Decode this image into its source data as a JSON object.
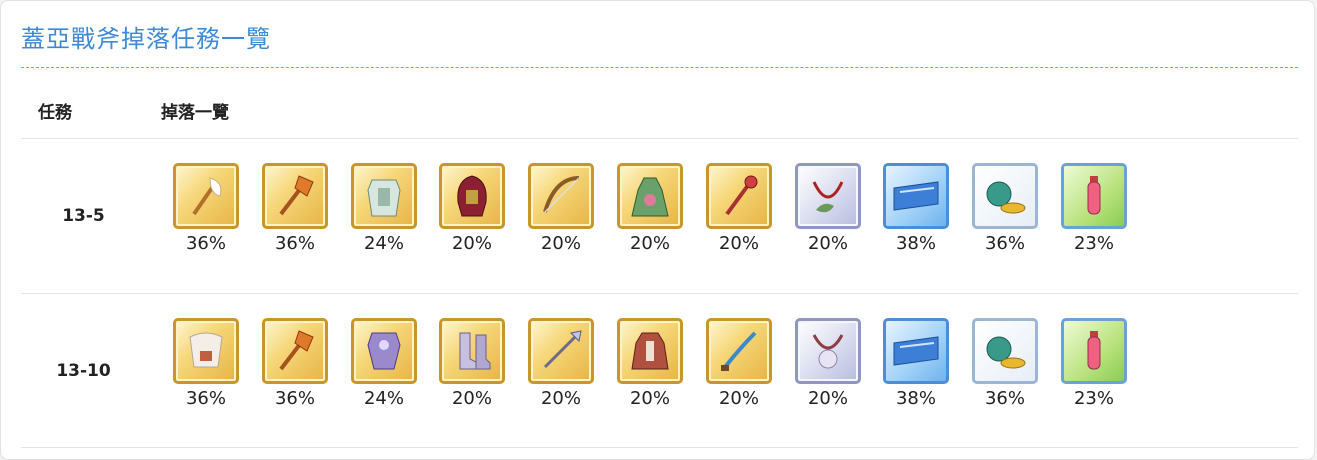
{
  "title": "蓋亞戰斧掉落任務一覽",
  "headers": {
    "mission": "任務",
    "drops": "掉落一覽"
  },
  "rows": [
    {
      "mission": "13-5",
      "drops": [
        {
          "icon": "feather-staff-icon",
          "rarity": "gold",
          "rate": "36%"
        },
        {
          "icon": "axe-icon",
          "rarity": "gold",
          "rate": "36%"
        },
        {
          "icon": "armor-icon",
          "rarity": "gold",
          "rate": "24%"
        },
        {
          "icon": "hood-icon",
          "rarity": "gold",
          "rate": "20%"
        },
        {
          "icon": "bow-icon",
          "rarity": "gold",
          "rate": "20%"
        },
        {
          "icon": "dress-icon",
          "rarity": "gold",
          "rate": "20%"
        },
        {
          "icon": "scepter-icon",
          "rarity": "gold",
          "rate": "20%"
        },
        {
          "icon": "laurel-amulet-icon",
          "rarity": "silver",
          "rate": "20%"
        },
        {
          "icon": "ticket-icon",
          "rarity": "blue",
          "rate": "38%"
        },
        {
          "icon": "coin-pouch-icon",
          "rarity": "white",
          "rate": "36%"
        },
        {
          "icon": "potion-icon",
          "rarity": "green",
          "rate": "23%"
        }
      ]
    },
    {
      "mission": "13-10",
      "drops": [
        {
          "icon": "beast-cloak-icon",
          "rarity": "gold",
          "rate": "36%"
        },
        {
          "icon": "axe-icon",
          "rarity": "gold",
          "rate": "36%"
        },
        {
          "icon": "knight-armor-icon",
          "rarity": "gold",
          "rate": "24%"
        },
        {
          "icon": "boots-icon",
          "rarity": "gold",
          "rate": "20%"
        },
        {
          "icon": "spear-icon",
          "rarity": "gold",
          "rate": "20%"
        },
        {
          "icon": "robe-icon",
          "rarity": "gold",
          "rate": "20%"
        },
        {
          "icon": "blade-icon",
          "rarity": "gold",
          "rate": "20%"
        },
        {
          "icon": "pendant-icon",
          "rarity": "silver",
          "rate": "20%"
        },
        {
          "icon": "ticket-icon",
          "rarity": "blue",
          "rate": "38%"
        },
        {
          "icon": "coin-pouch-icon",
          "rarity": "white",
          "rate": "36%"
        },
        {
          "icon": "potion-icon",
          "rarity": "green",
          "rate": "23%"
        }
      ]
    }
  ]
}
